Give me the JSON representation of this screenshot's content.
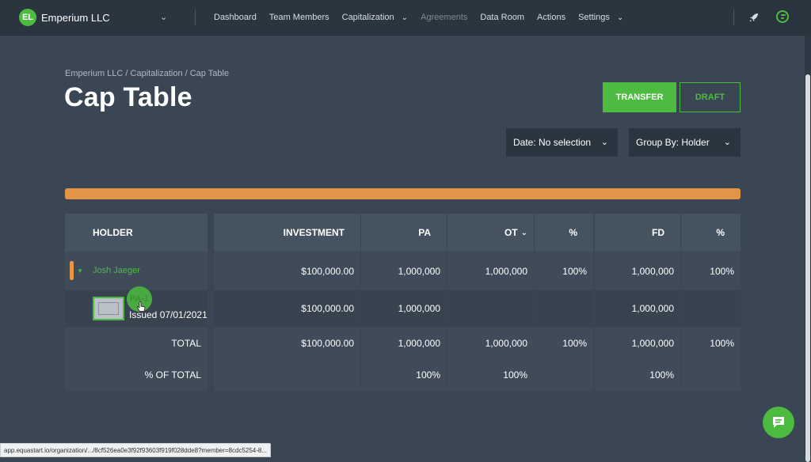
{
  "org": {
    "initials": "EL",
    "name": "Emperium LLC"
  },
  "nav": {
    "dashboard": "Dashboard",
    "team_members": "Team Members",
    "capitalization": "Capitalization",
    "agreements": "Agreements",
    "data_room": "Data Room",
    "actions": "Actions",
    "settings": "Settings"
  },
  "page": {
    "breadcrumb": "Emperium LLC / Capitalization  / Cap Table",
    "title": "Cap Table"
  },
  "buttons": {
    "transfer": "TRANSFER",
    "draft": "DRAFT"
  },
  "filters": {
    "date": "Date: No selection",
    "group_by": "Group By: Holder"
  },
  "progress": {
    "percent": 100,
    "color": "#e29447"
  },
  "table": {
    "headers": {
      "holder": "HOLDER",
      "investment": "INVESTMENT",
      "pa": "PA",
      "ot": "OT",
      "pct1": "%",
      "fd": "FD",
      "pct2": "%"
    },
    "holder_row": {
      "name": "Josh Jaeger",
      "investment": "$100,000.00",
      "pa": "1,000,000",
      "ot": "1,000,000",
      "pct1": "100%",
      "fd": "1,000,000",
      "pct2": "100%"
    },
    "certificate_row": {
      "id": "PA-1",
      "issued": "Issued 07/01/2021",
      "investment": "$100,000.00",
      "pa": "1,000,000",
      "fd": "1,000,000"
    },
    "total_row": {
      "label": "TOTAL",
      "investment": "$100,000.00",
      "pa": "1,000,000",
      "ot": "1,000,000",
      "pct1": "100%",
      "fd": "1,000,000",
      "pct2": "100%"
    },
    "pct_total_row": {
      "label": "% OF TOTAL",
      "pa": "100%",
      "ot": "100%",
      "fd": "100%"
    }
  },
  "status_url": "app.equastart.io/organization/.../8cf526ea0e3f92f93603f919f028dde8?member=8cdc5254-8...",
  "colors": {
    "accent": "#4cbb3f",
    "background": "#3a4654",
    "nav": "#2b3540",
    "warning": "#e29447"
  }
}
